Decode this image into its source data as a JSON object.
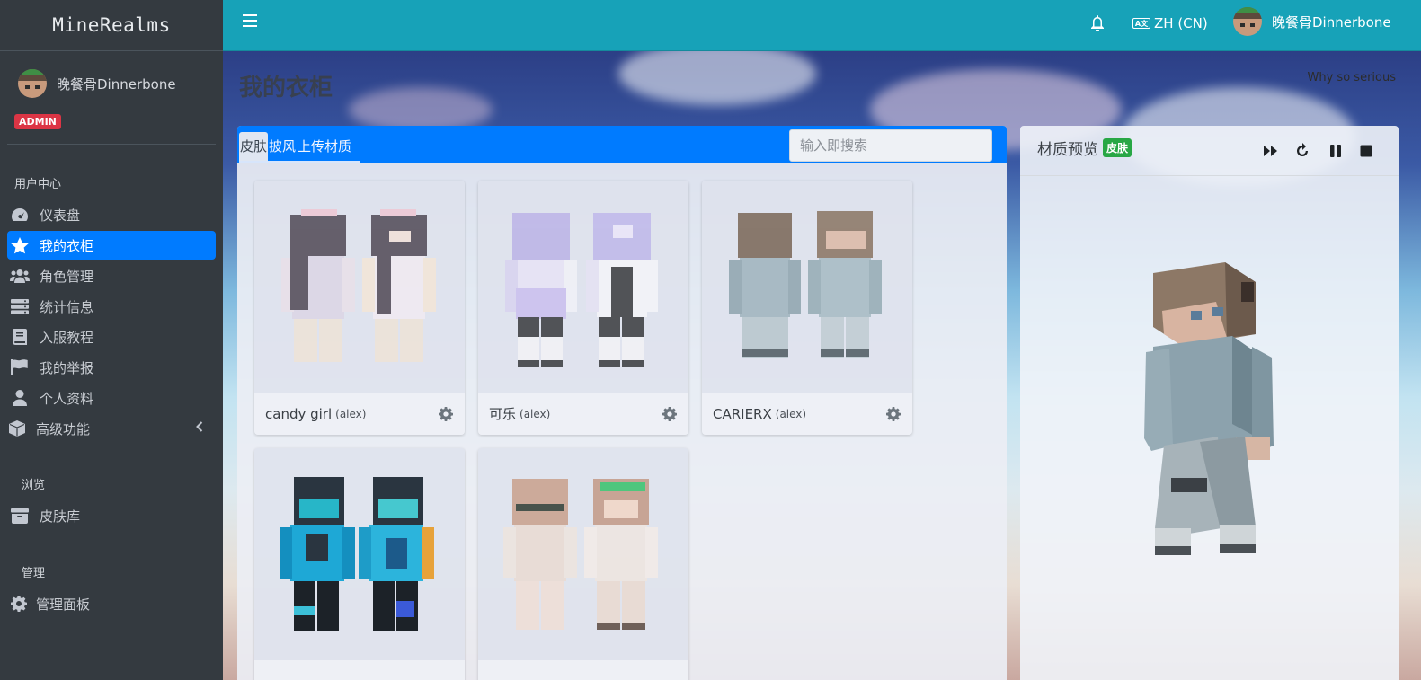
{
  "brand": {
    "name": "MineRealms"
  },
  "user": {
    "name": "晚餐骨Dinnerbone",
    "role_badge": "ADMIN"
  },
  "sidebar": {
    "sections": [
      {
        "header": "用户中心",
        "items": [
          {
            "label": "仪表盘",
            "icon": "dashboard-icon"
          },
          {
            "label": "我的衣柜",
            "icon": "star-icon",
            "active": true
          },
          {
            "label": "角色管理",
            "icon": "users-icon"
          },
          {
            "label": "统计信息",
            "icon": "server-icon"
          },
          {
            "label": "入服教程",
            "icon": "book-icon"
          },
          {
            "label": "我的举报",
            "icon": "flag-icon"
          },
          {
            "label": "个人资料",
            "icon": "user-icon"
          },
          {
            "label": "高级功能",
            "icon": "cube-icon",
            "has_submenu": true
          }
        ]
      },
      {
        "header": "浏览",
        "items": [
          {
            "label": "皮肤库",
            "icon": "archive-icon"
          }
        ]
      },
      {
        "header": "管理",
        "items": [
          {
            "label": "管理面板",
            "icon": "gear-icon"
          }
        ]
      }
    ]
  },
  "topbar": {
    "language": "ZH (CN)",
    "language_icon": "language-icon",
    "notification_icon": "bell-icon",
    "user_name": "晚餐骨Dinnerbone"
  },
  "page": {
    "title": "我的衣柜",
    "quote": "Why so serious"
  },
  "closet": {
    "tabs": [
      {
        "label": "皮肤",
        "active": true
      },
      {
        "label": "披风"
      },
      {
        "label": "上传材质"
      }
    ],
    "search_placeholder": "输入即搜索",
    "items": [
      {
        "name": "candy girl",
        "model": "(alex)",
        "skin": "candy"
      },
      {
        "name": "可乐",
        "model": "(alex)",
        "skin": "kele"
      },
      {
        "name": "CARIERX",
        "model": "(alex)",
        "skin": "carierx"
      },
      {
        "name": "",
        "model": "",
        "skin": "cyan"
      },
      {
        "name": "",
        "model": "",
        "skin": "peach"
      }
    ]
  },
  "preview": {
    "title": "材质预览",
    "badge": "皮肤",
    "controls": [
      "fast-forward-icon",
      "reset-icon",
      "pause-icon",
      "stop-icon"
    ]
  },
  "colors": {
    "sidebar": "#343a40",
    "topbar": "#17a2b8",
    "primary": "#007bff",
    "danger": "#dc3545",
    "success": "#28a745"
  }
}
